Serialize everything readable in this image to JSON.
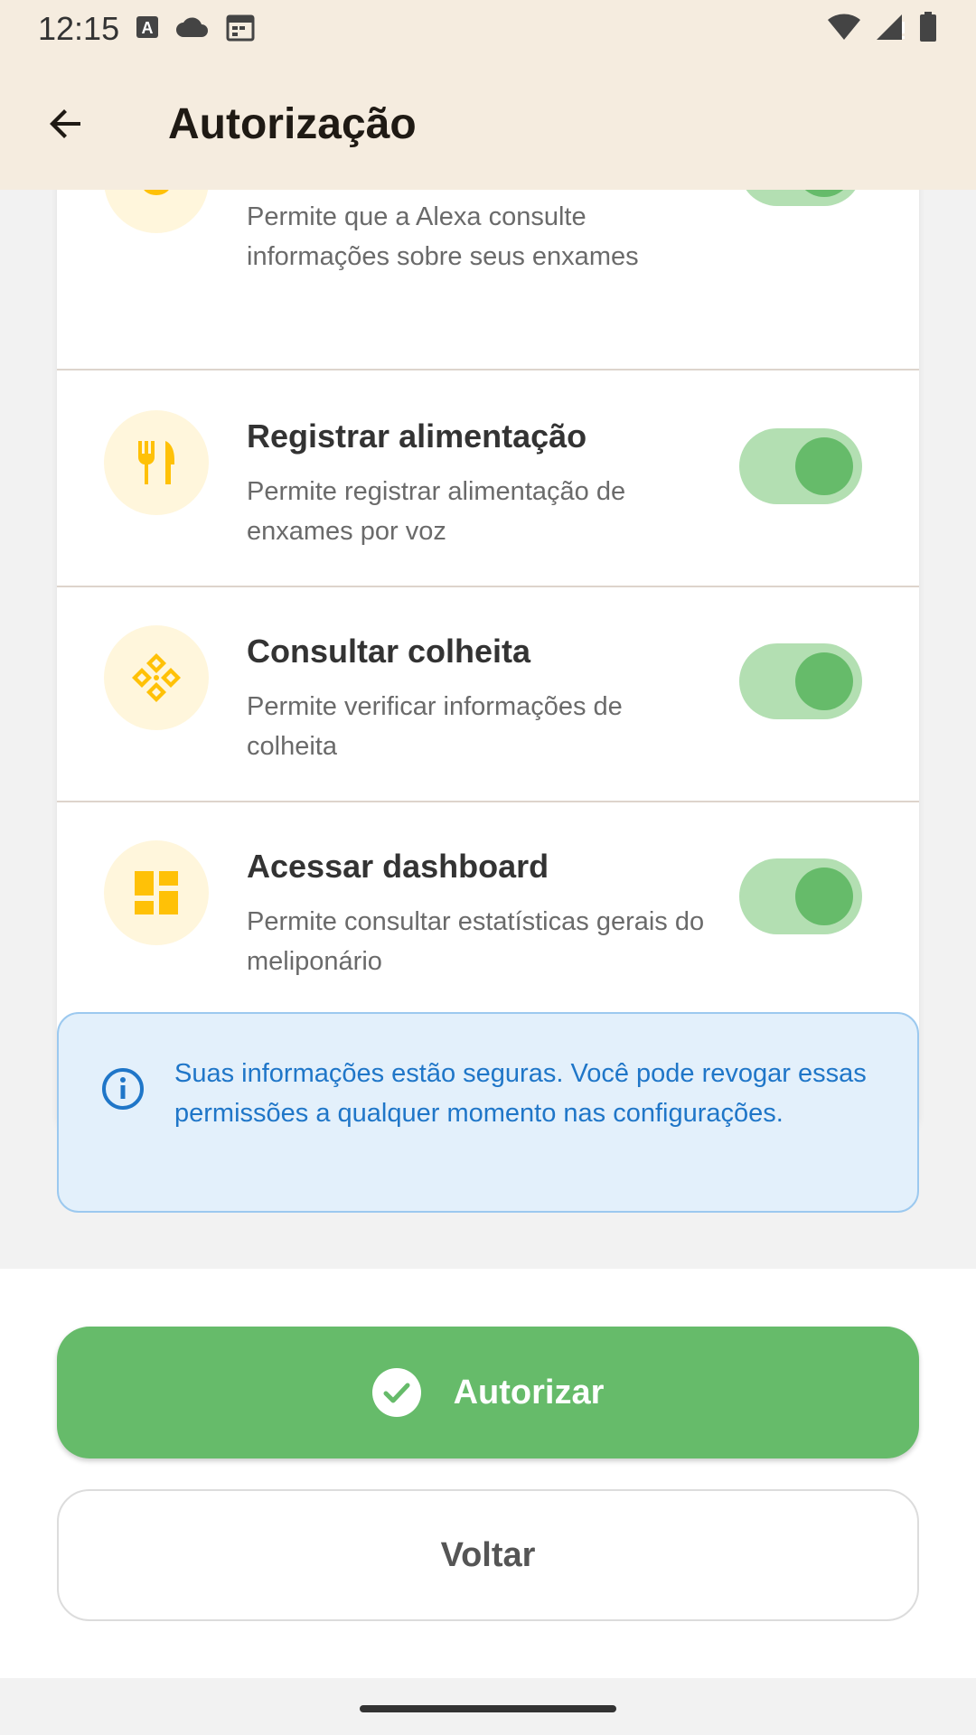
{
  "status_bar": {
    "time": "12:15",
    "icons_left": [
      "a-badge-icon",
      "cloud-icon",
      "calendar-icon"
    ],
    "icons_right": [
      "wifi-icon",
      "signal-icon",
      "battery-icon"
    ]
  },
  "app_bar": {
    "title": "Autorização"
  },
  "permissions": [
    {
      "title": "",
      "description": "Permite que a Alexa consulte informações sobre seus enxames",
      "icon": "bee-icon",
      "enabled": true
    },
    {
      "title": "Registrar alimentação",
      "description": "Permite registrar alimentação de enxames por voz",
      "icon": "restaurant-icon",
      "enabled": true
    },
    {
      "title": "Consultar colheita",
      "description": "Permite verificar informações de colheita",
      "icon": "harvest-icon",
      "enabled": true
    },
    {
      "title": "Acessar dashboard",
      "description": "Permite consultar estatísticas gerais do meliponário",
      "icon": "dashboard-icon",
      "enabled": true
    }
  ],
  "info": {
    "text": "Suas informações estão seguras. Você pode revogar essas permissões a qualquer momento nas configurações."
  },
  "actions": {
    "authorize_label": "Autorizar",
    "back_label": "Voltar"
  },
  "colors": {
    "header_bg": "#f5ecdf",
    "accent_green": "#66bb6a",
    "icon_amber": "#ffc107",
    "info_blue": "#1f76c8"
  }
}
